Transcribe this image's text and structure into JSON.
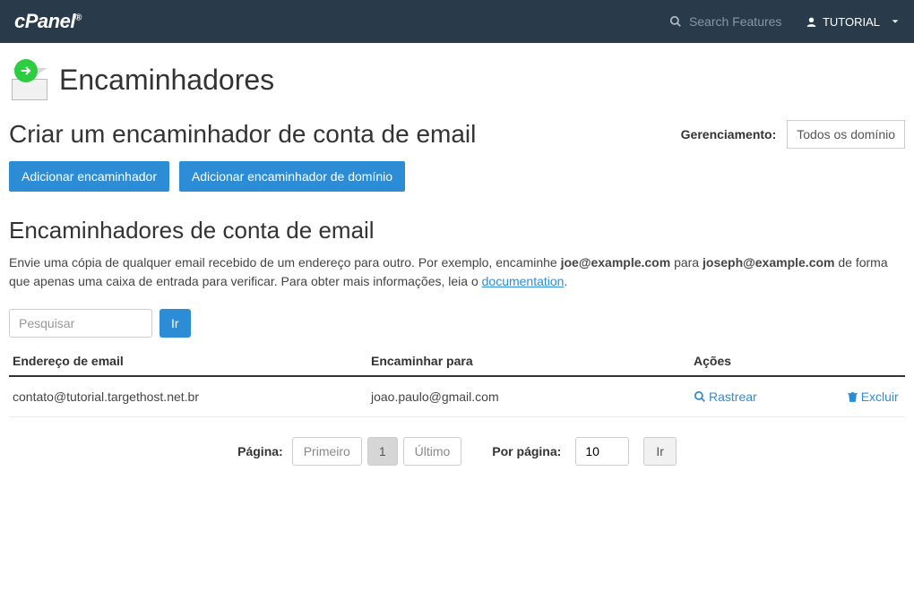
{
  "branding": {
    "name": "cPanel"
  },
  "topbar": {
    "search_placeholder": "Search Features",
    "user_label": "TUTORIAL"
  },
  "page": {
    "title": "Encaminhadores",
    "create_heading": "Criar um encaminhador de conta de email",
    "management_label": "Gerenciamento:",
    "management_value": "Todos os domínio",
    "buttons": {
      "add_forwarder": "Adicionar encaminhador",
      "add_domain_forwarder": "Adicionar encaminhador de domínio"
    },
    "list_heading": "Encaminhadores de conta de email",
    "description": {
      "part1": "Envie uma cópia de qualquer email recebido de um endereço para outro. Por exemplo, encaminhe ",
      "bold1": "joe@example.com",
      "part2": " para ",
      "bold2": "joseph@example.com",
      "part3": " de forma que apenas uma caixa de entrada para verificar. Para obter mais informações, leia o ",
      "link": "documentation",
      "part4": "."
    },
    "search": {
      "placeholder": "Pesquisar",
      "go": "Ir"
    },
    "table": {
      "headers": {
        "email": "Endereço de email",
        "forward": "Encaminhar para",
        "actions": "Ações"
      },
      "rows": [
        {
          "email": "contato@tutorial.targethost.net.br",
          "forward": "joao.paulo@gmail.com"
        }
      ],
      "action_trace": "Rastrear",
      "action_delete": "Excluir"
    },
    "pagination": {
      "page_label": "Página:",
      "first": "Primeiro",
      "current": "1",
      "last": "Último",
      "perpage_label": "Por página:",
      "perpage_value": "10",
      "go": "Ir"
    }
  }
}
